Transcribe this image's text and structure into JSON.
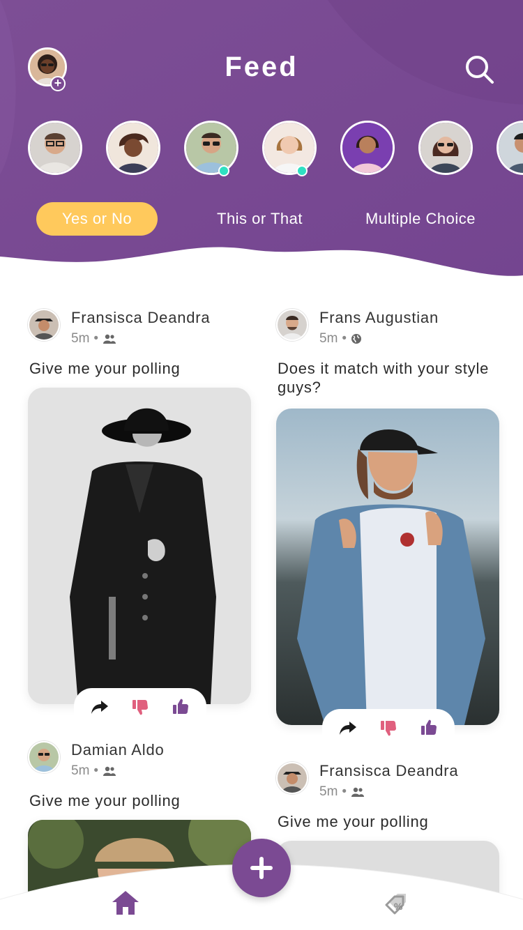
{
  "header": {
    "title": "Feed",
    "profile_icon": "user-avatar",
    "add_icon": "plus-icon",
    "search_icon": "search-icon"
  },
  "stories": [
    {
      "name": "story-1",
      "online": false
    },
    {
      "name": "story-2",
      "online": false
    },
    {
      "name": "story-3",
      "online": true
    },
    {
      "name": "story-4",
      "online": true
    },
    {
      "name": "story-5",
      "online": false
    },
    {
      "name": "story-6",
      "online": false
    },
    {
      "name": "story-7",
      "online": false
    }
  ],
  "tabs": [
    {
      "label": "Yes or No",
      "active": true
    },
    {
      "label": "This or That",
      "active": false
    },
    {
      "label": "Multiple Choice",
      "active": false
    }
  ],
  "posts": [
    {
      "author": "Fransisca Deandra",
      "time": "5m",
      "audience_icon": "group-icon",
      "question": "Give me your polling"
    },
    {
      "author": "Frans Augustian",
      "time": "5m",
      "audience_icon": "globe-icon",
      "question": "Does it match with your style guys?"
    },
    {
      "author": "Damian Aldo",
      "time": "5m",
      "audience_icon": "group-icon",
      "question": "Give me your polling"
    },
    {
      "author": "Fransisca Deandra",
      "time": "5m",
      "audience_icon": "group-icon",
      "question": "Give me your polling"
    }
  ],
  "actions": {
    "share_icon": "share-icon",
    "dislike_icon": "thumbs-down-icon",
    "like_icon": "thumbs-up-icon"
  },
  "nav": {
    "home_icon": "home-icon",
    "create_icon": "plus-icon",
    "deals_icon": "discount-tag-icon"
  },
  "colors": {
    "primary": "#7b4a93",
    "accent": "#ffc95c",
    "online": "#2fe0c2",
    "dislike": "#e0607e",
    "like": "#7b4a93"
  }
}
